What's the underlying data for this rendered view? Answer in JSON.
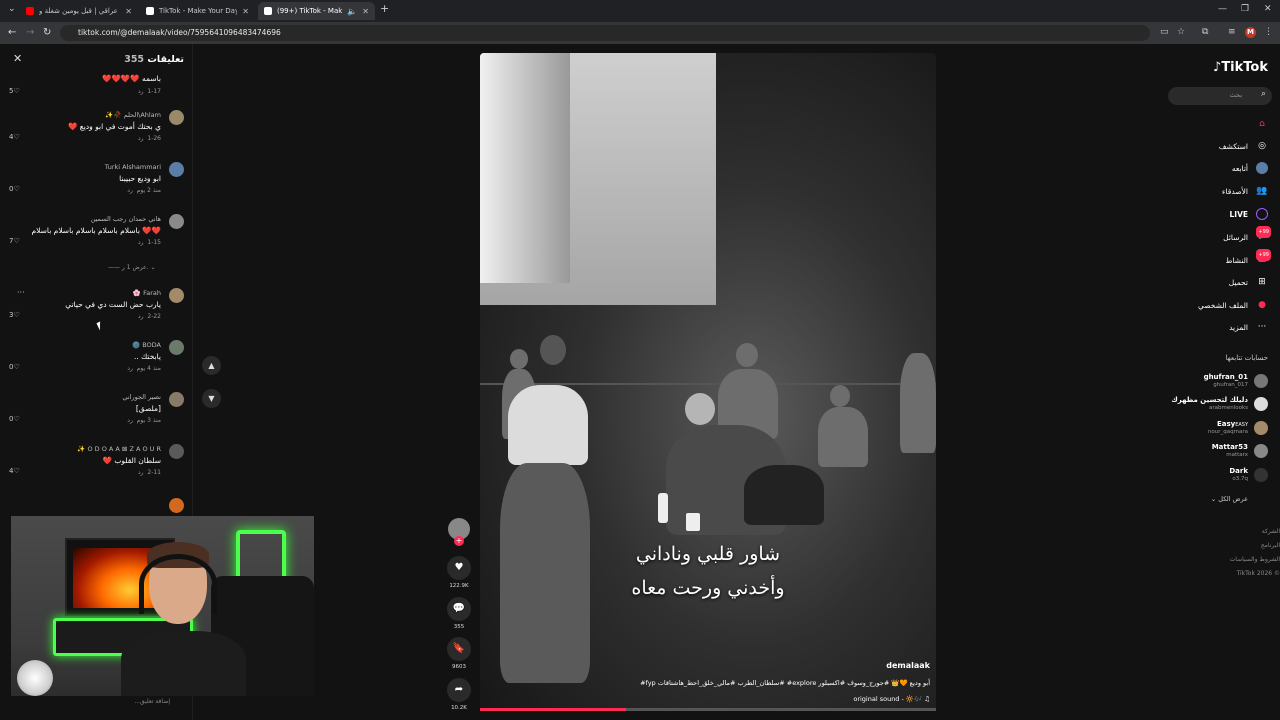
{
  "browser": {
    "tabs": [
      {
        "title": "اغاني عراقي | قبل يومين شغلة و",
        "favicon_color": "#ff0000"
      },
      {
        "title": "TikTok - Make Your Day",
        "favicon_color": "#ffffff"
      },
      {
        "title": "(99+) TikTok - Make Your D",
        "favicon_color": "#ffffff"
      }
    ],
    "url": "tiktok.com/@demalaak/video/7595641096483474696",
    "profile_initial": "M"
  },
  "comments": {
    "title": "تعليقات",
    "count": "355",
    "items": [
      {
        "user": "",
        "text": "باسمه ❤️❤️❤️❤️",
        "date": "1-17",
        "reply": "رد",
        "likes": "5",
        "avatar_color": "#7a6a58"
      },
      {
        "user": "Ahlam\\الحلم 🥀✨",
        "text": "ي بحتك أموت في ابو وديع ❤️",
        "date": "1-26",
        "reply": "رد",
        "likes": "4",
        "avatar_color": "#9b8a6a"
      },
      {
        "user": "Turki Alshammari",
        "text": "ابو وديع حبيبنا",
        "date": "منذ 2 يوم",
        "reply": "رد",
        "likes": "0",
        "avatar_color": "#5b7ea8"
      },
      {
        "user": "هاني حمدان رجب السمين",
        "text": "❤️❤️ باسلام باسلام باسلام باسلام باسلام",
        "date": "1-15",
        "reply": "رد",
        "likes": "7",
        "avatar_color": "#8a8a8a"
      },
      {
        "user": "Farah 🌸",
        "text": "يارب حض الست دي في حياتي",
        "date": "2-22",
        "reply": "رد",
        "likes": "3",
        "avatar_color": "#a58a6a"
      },
      {
        "user": "BODA 🌚",
        "text": "يابختك ..",
        "date": "منذ 4 يوم",
        "reply": "رد",
        "likes": "0",
        "avatar_color": "#6b7b6b"
      },
      {
        "user": "نصير الجوراني",
        "text": "[ملصق]",
        "date": "منذ 3 يوم",
        "reply": "رد",
        "likes": "0",
        "avatar_color": "#8a7a6a"
      },
      {
        "user": "O D O A A ⊠ Z A O U R ✨",
        "text": "سلطان القلوب ❤️",
        "date": "2-11",
        "reply": "رد",
        "likes": "4",
        "avatar_color": "#5a5a5a"
      }
    ],
    "more_replies": "عرض 1 ر.",
    "add_comment_placeholder": "إضافة تعليق..."
  },
  "actions": {
    "likes": "122.9K",
    "comments": "355",
    "saves": "9603",
    "shares": "10.2K"
  },
  "video": {
    "lyric_line1": "شاور قلبي وناداني",
    "lyric_line2": "وأخدني ورحت معاه",
    "author": "demalaak",
    "caption": "أبو وديع 🧡👑 #جورج_وسوف #اكسبلور explore# #سلطان_الطرب #مالي_خلق_احط_هاشتاقات fyp#",
    "sound": "original sound - 🔆🎶 ♫",
    "progress": 0.32
  },
  "sidebar": {
    "logo": "TikTok",
    "search_placeholder": "بحث",
    "nav": [
      {
        "label": "",
        "icon": "home-icon",
        "color": "#fe2c55"
      },
      {
        "label": "استكشف",
        "icon": "compass-icon"
      },
      {
        "label": "أتابعه",
        "icon": "avatar-icon"
      },
      {
        "label": "الأصدقاء",
        "icon": "friends-icon"
      },
      {
        "label": "LIVE",
        "icon": "live-icon"
      },
      {
        "label": "الرسائل",
        "icon": "message-icon",
        "badge": "99+"
      },
      {
        "label": "النشاط",
        "icon": "inbox-icon",
        "badge": "99+"
      },
      {
        "label": "تحميل",
        "icon": "upload-icon"
      },
      {
        "label": "الملف الشخصي",
        "icon": "profile-icon"
      },
      {
        "label": "المزيد",
        "icon": "more-icon"
      }
    ],
    "following_title": "حسابات تتابعها",
    "following": [
      {
        "name": "ghufran_01",
        "sub": "ghufran_017"
      },
      {
        "name": "دليلك لتحسين مظهرك",
        "sub": "arabmenlooks"
      },
      {
        "name": "Easy",
        "sub": "nour_qaqmara",
        "tag": "EASY"
      },
      {
        "name": "Mattar53",
        "sub": "mattarx"
      },
      {
        "name": "Dark",
        "sub": "o3.7q"
      }
    ],
    "see_all": "عرض الكل",
    "footer": [
      "الشركة",
      "البرنامج",
      "الشروط والسياسات",
      "TikTok 2026 ©"
    ]
  }
}
